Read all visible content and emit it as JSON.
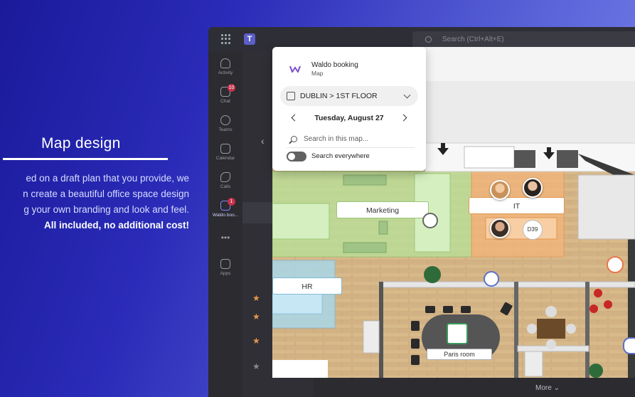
{
  "promo": {
    "title": "Map design",
    "line1": "ed on a draft plan that you provide, we",
    "line2": "n create a beautiful office space design",
    "line3": "g your own branding and look and feel.",
    "line4": "All included, no additional cost!"
  },
  "teams": {
    "search_placeholder": "Search (Ctrl+Alt+E)",
    "rail": {
      "activity": "Activity",
      "chat": "Chat",
      "chat_badge": "10",
      "teams": "Teams",
      "calendar": "Calendar",
      "calls": "Calls",
      "waldo": "Waldo boo...",
      "waldo_badge": "1",
      "apps": "Apps"
    },
    "more_label": "More"
  },
  "card": {
    "app_name": "Waldo booking",
    "app_sub": "Map",
    "location": "DUBLIN > 1ST FLOOR",
    "date": "Tuesday, August 27",
    "search_placeholder": "Search in this map...",
    "search_everywhere": "Search everywhere"
  },
  "map": {
    "zones": {
      "marketing": "Marketing",
      "it": "IT",
      "hr": "HR",
      "paris_room": "Paris room"
    },
    "desk_badge": "D39"
  },
  "colors": {
    "accent": "#5b5fc7",
    "marketing_zone": "#b8e39a",
    "it_zone": "#f4b57a",
    "hr_zone": "#a7d9ee"
  }
}
